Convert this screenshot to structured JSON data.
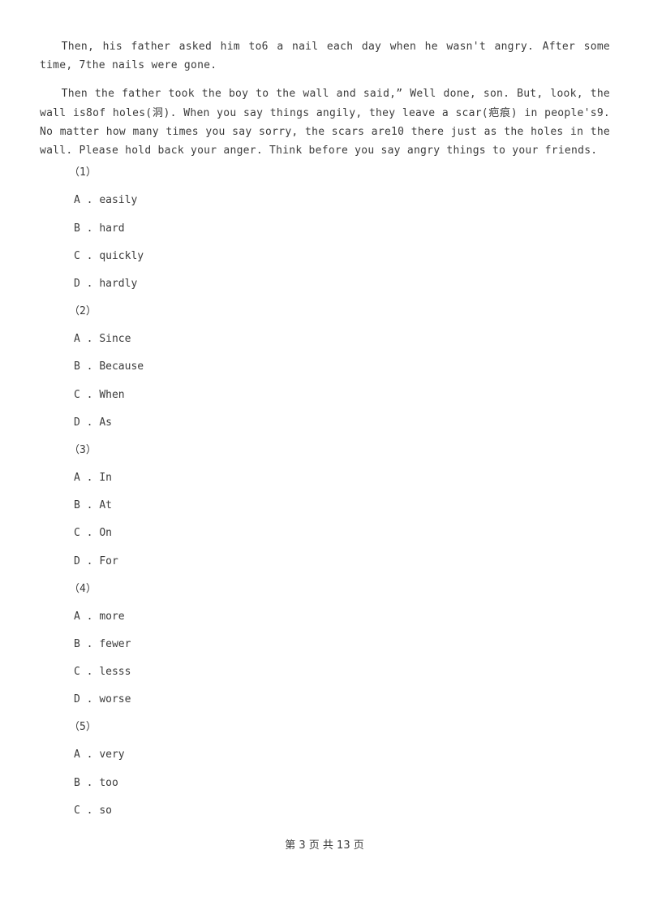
{
  "document": {
    "paragraphs": [
      "Then, his father asked him to6 a nail each day when he wasn't angry. After some time, 7the nails were gone.",
      "Then the father took the boy to the wall and said,” Well done, son. But, look, the wall is8of holes(洞). When you say things angily, they leave a scar(疤痕) in people's9. No matter how many times you say sorry, the scars are10 there just as the holes in the wall. Please hold back your anger. Think before you say angry things to your friends."
    ],
    "questions": [
      {
        "number": "（1）",
        "options": [
          {
            "letter": "A",
            "separator": " . ",
            "text": "easily"
          },
          {
            "letter": "B",
            "separator": " . ",
            "text": "hard"
          },
          {
            "letter": "C",
            "separator": " . ",
            "text": "quickly"
          },
          {
            "letter": "D",
            "separator": " . ",
            "text": "hardly"
          }
        ]
      },
      {
        "number": "（2）",
        "options": [
          {
            "letter": "A",
            "separator": " . ",
            "text": "Since"
          },
          {
            "letter": "B",
            "separator": " . ",
            "text": "Because"
          },
          {
            "letter": "C",
            "separator": " . ",
            "text": "When"
          },
          {
            "letter": "D",
            "separator": " . ",
            "text": "As"
          }
        ]
      },
      {
        "number": "（3）",
        "options": [
          {
            "letter": "A",
            "separator": " . ",
            "text": "In"
          },
          {
            "letter": "B",
            "separator": " . ",
            "text": "At"
          },
          {
            "letter": "C",
            "separator": " . ",
            "text": "On"
          },
          {
            "letter": "D",
            "separator": " . ",
            "text": "For"
          }
        ]
      },
      {
        "number": "（4）",
        "options": [
          {
            "letter": "A",
            "separator": " . ",
            "text": "more"
          },
          {
            "letter": "B",
            "separator": " . ",
            "text": "fewer"
          },
          {
            "letter": "C",
            "separator": " . ",
            "text": "lesss"
          },
          {
            "letter": "D",
            "separator": " . ",
            "text": "worse"
          }
        ]
      },
      {
        "number": "（5）",
        "options": [
          {
            "letter": "A",
            "separator": " . ",
            "text": "very"
          },
          {
            "letter": "B",
            "separator": " . ",
            "text": "too"
          },
          {
            "letter": "C",
            "separator": " . ",
            "text": "so"
          }
        ]
      }
    ],
    "footer": "第 3 页 共 13 页"
  }
}
